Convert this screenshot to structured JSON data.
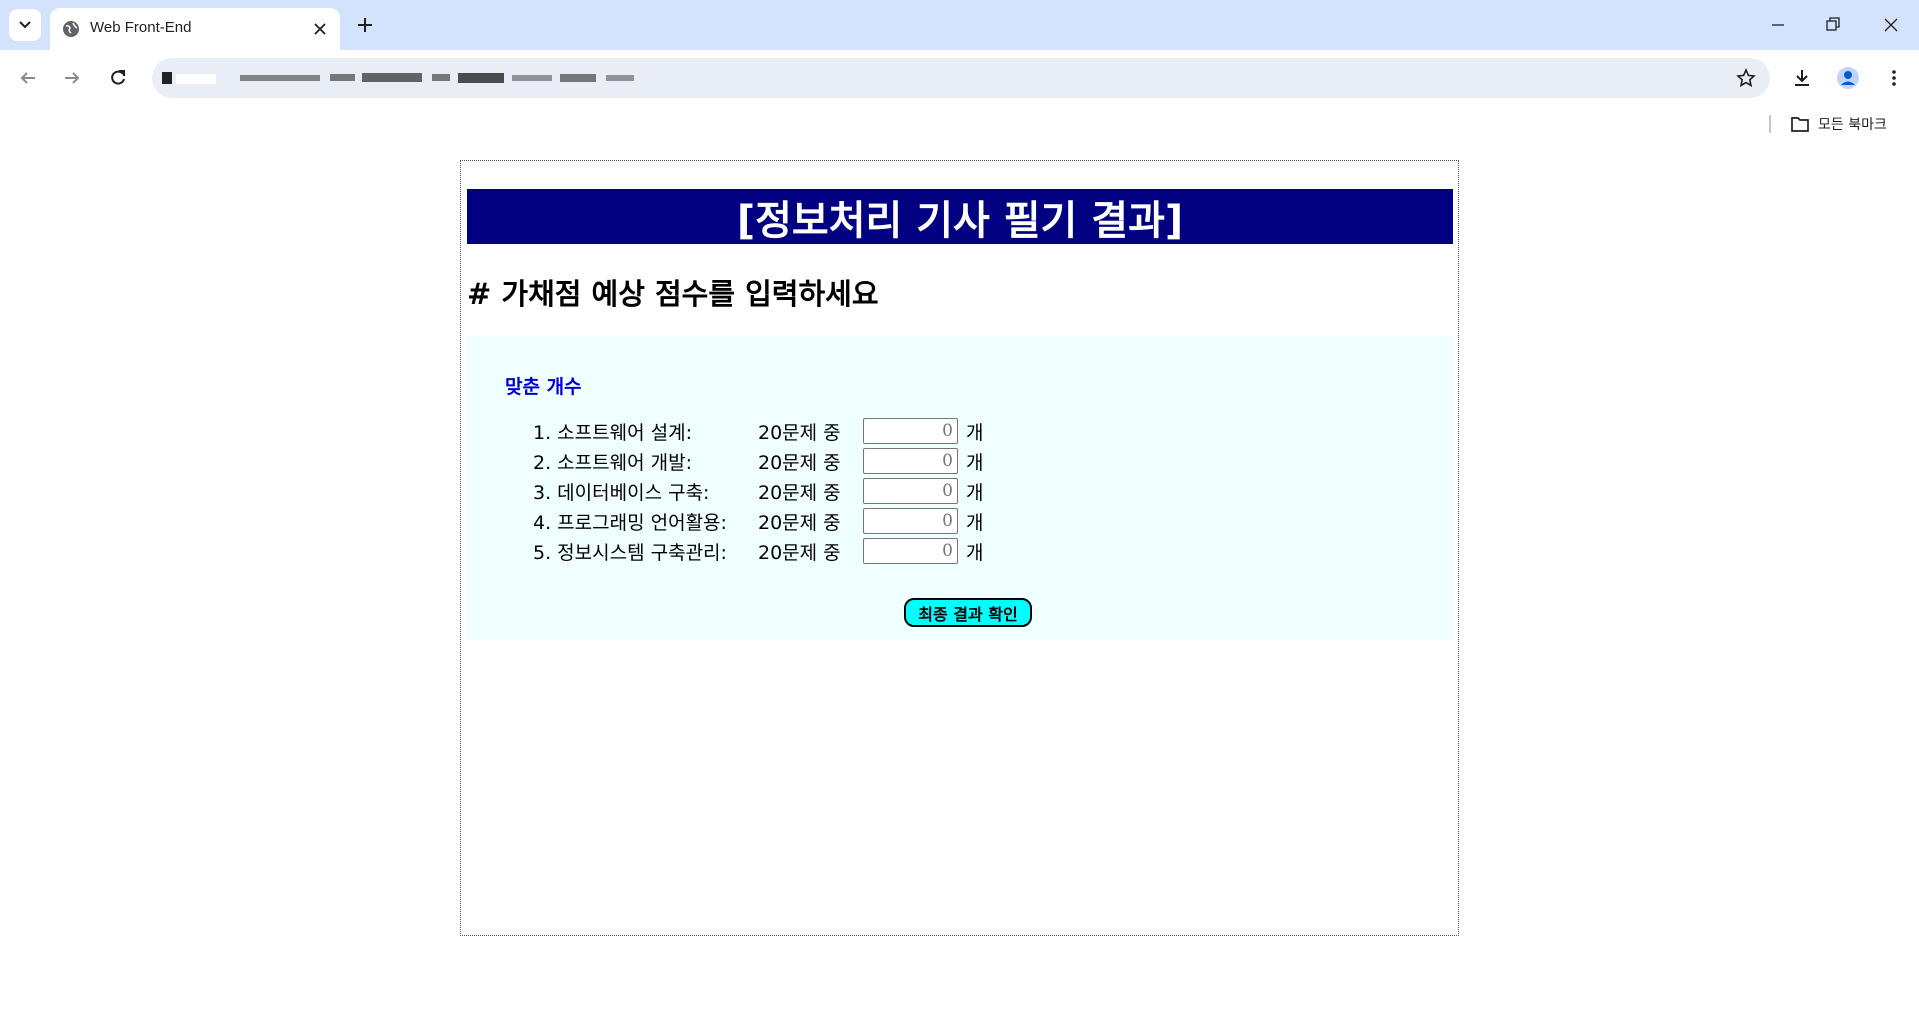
{
  "browser": {
    "tab_title": "Web Front-End",
    "bookmarks_all": "모든 북마크"
  },
  "page": {
    "title": "[정보처리 기사 필기 결과]",
    "subtitle": "# 가채점 예상 점수를 입력하세요",
    "section_label": "맞춘 개수",
    "rows": [
      {
        "label": "1. 소프트웨어 설계:",
        "of": "20문제 중",
        "value": "0",
        "unit": "개"
      },
      {
        "label": "2. 소프트웨어 개발:",
        "of": "20문제 중",
        "value": "0",
        "unit": "개"
      },
      {
        "label": "3. 데이터베이스 구축:",
        "of": "20문제 중",
        "value": "0",
        "unit": "개"
      },
      {
        "label": "4. 프로그래밍 언어활용:",
        "of": "20문제 중",
        "value": "0",
        "unit": "개"
      },
      {
        "label": "5. 정보시스템 구축관리:",
        "of": "20문제 중",
        "value": "0",
        "unit": "개"
      }
    ],
    "submit_label": "최종 결과 확인"
  },
  "colors": {
    "tabstrip": "#d3e3fd",
    "title_bg": "#000080",
    "panel_bg": "#f0ffff",
    "section_label": "#0000cd",
    "button_bg": "#00ffff"
  },
  "icons": [
    "tab-search-icon",
    "globe-icon",
    "close-icon",
    "plus-icon",
    "minimize-icon",
    "restore-icon",
    "window-close-icon",
    "back-arrow-icon",
    "forward-arrow-icon",
    "reload-icon",
    "star-icon",
    "download-icon",
    "profile-icon",
    "more-menu-icon",
    "folder-icon"
  ]
}
